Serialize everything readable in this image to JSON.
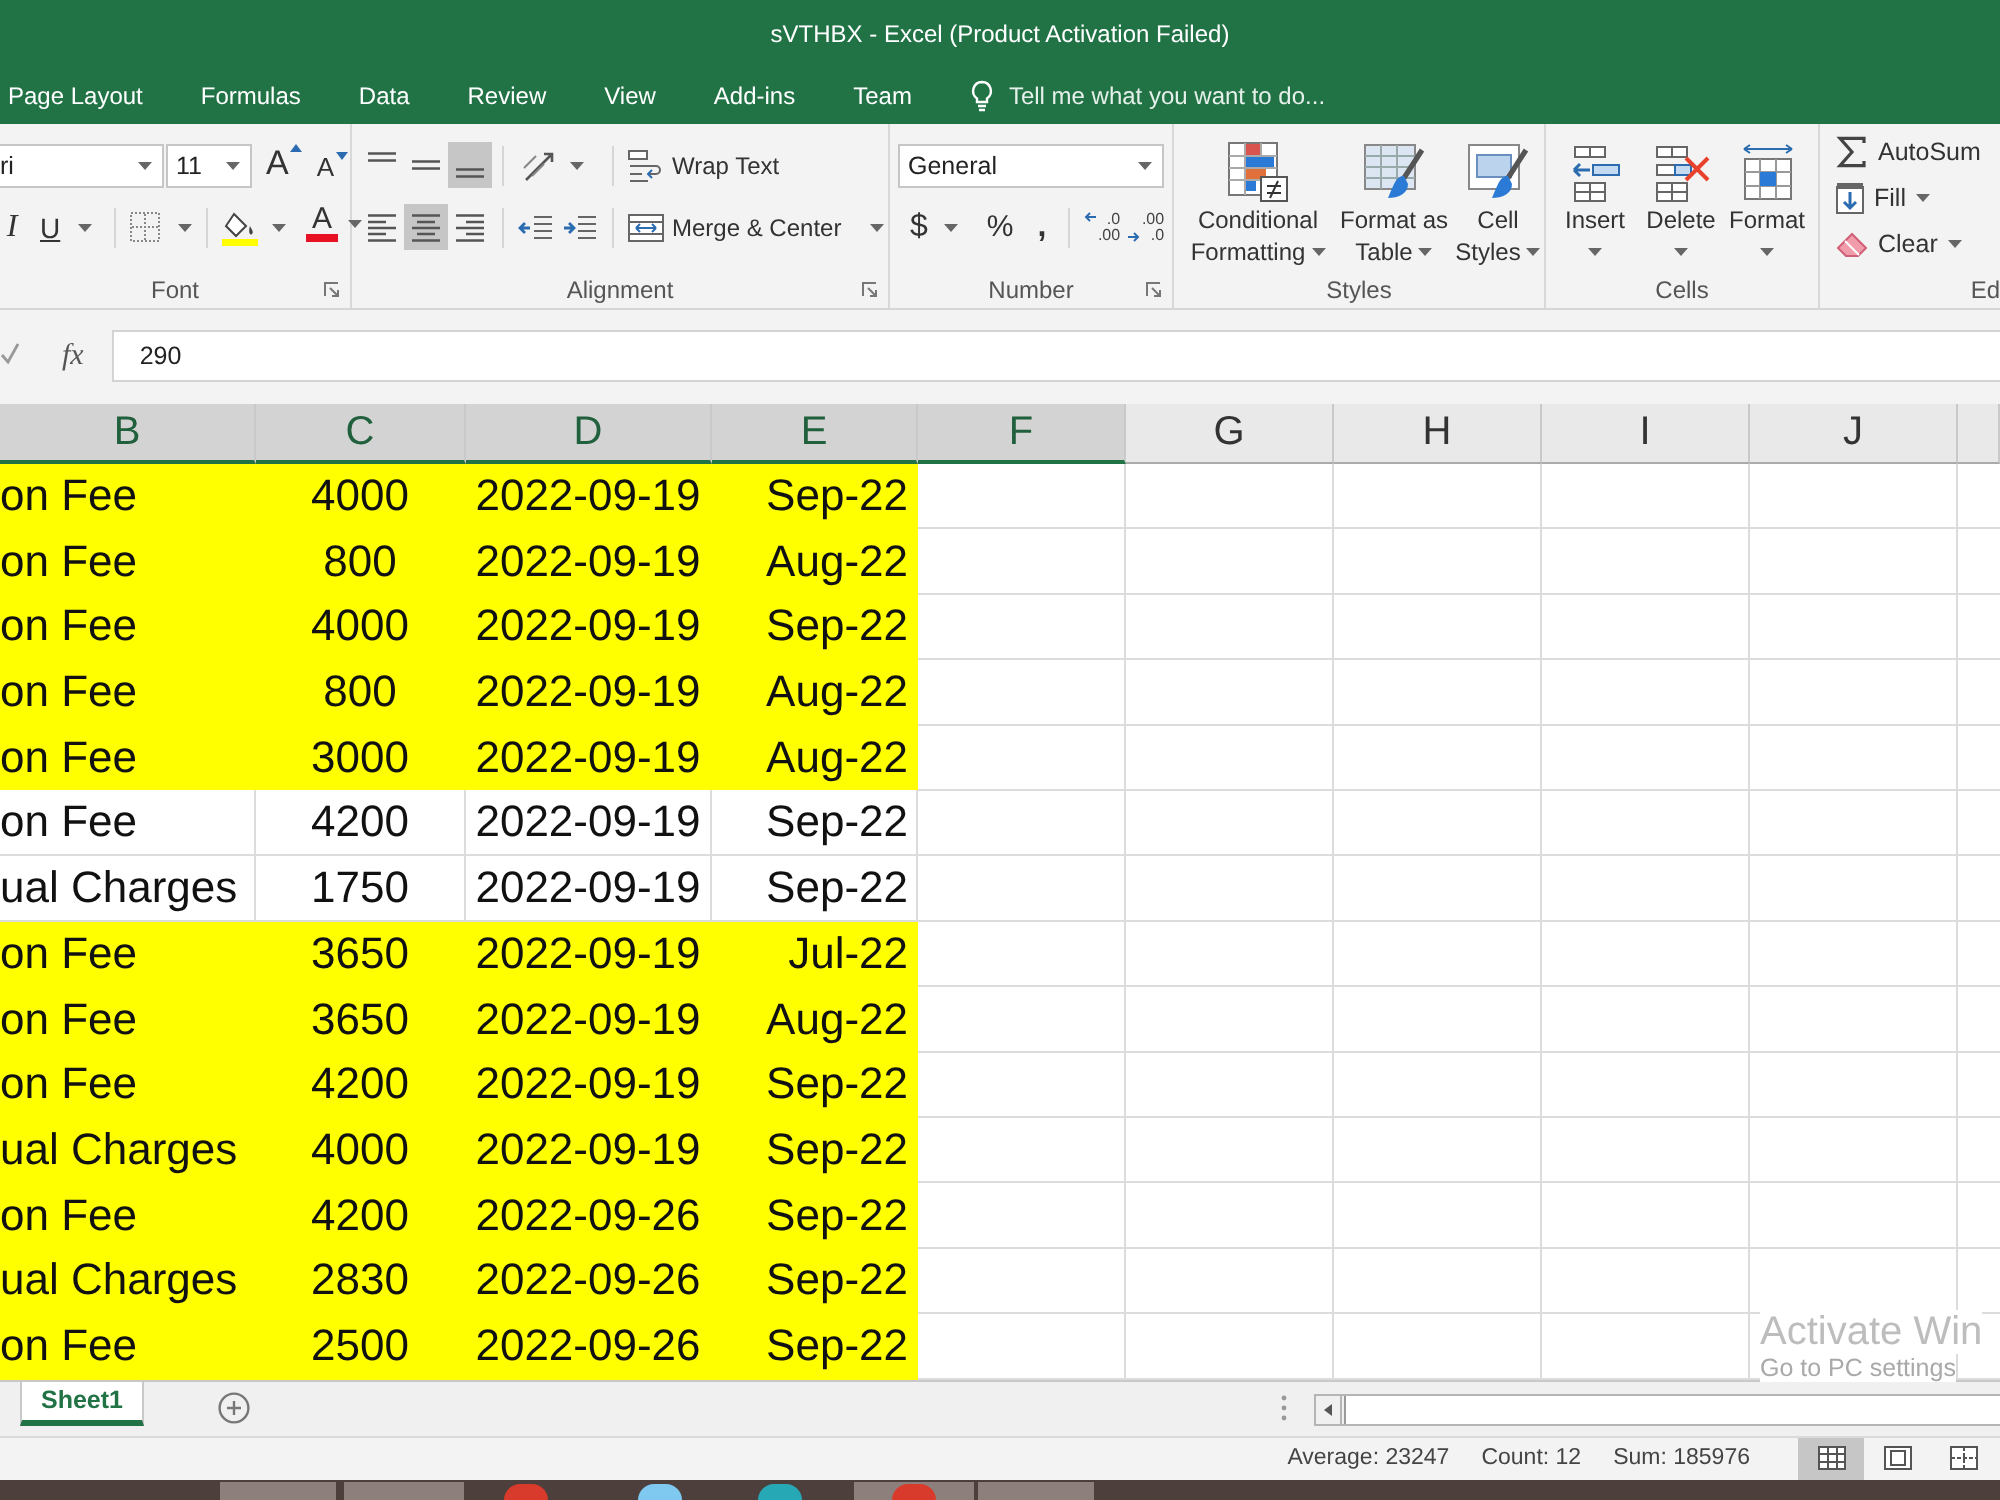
{
  "window": {
    "title": "sVTHBX - Excel (Product Activation Failed)"
  },
  "ribbon_tabs": [
    {
      "label": "Page Layout",
      "selected": false
    },
    {
      "label": "Formulas",
      "selected": false
    },
    {
      "label": "Data",
      "selected": false
    },
    {
      "label": "Review",
      "selected": false
    },
    {
      "label": "View",
      "selected": false
    },
    {
      "label": "Add-ins",
      "selected": false
    },
    {
      "label": "Team",
      "selected": false
    }
  ],
  "tell_me": {
    "placeholder": "Tell me what you want to do..."
  },
  "font_group": {
    "label": "Font",
    "font_name": "ri",
    "font_size": "11",
    "grow_glyph": "A",
    "shrink_glyph": "A",
    "italic_glyph": "I",
    "underline_glyph": "U",
    "font_color_glyph": "A"
  },
  "alignment_group": {
    "label": "Alignment",
    "vertical": [
      {
        "kind": "top",
        "selected": false
      },
      {
        "kind": "middle",
        "selected": false
      },
      {
        "kind": "bottom",
        "selected": true
      }
    ],
    "horizontal": [
      {
        "kind": "left",
        "selected": false
      },
      {
        "kind": "center",
        "selected": true
      },
      {
        "kind": "right",
        "selected": false
      }
    ],
    "wrap_text": "Wrap Text",
    "merge": "Merge & Center"
  },
  "number_group": {
    "label": "Number",
    "format": "General",
    "currency": "$",
    "percent": "%",
    "comma": ",",
    "decimals": [
      {
        "kind": "increase",
        "upper": ".0",
        "lower": ".00"
      },
      {
        "kind": "decrease",
        "upper": ".00",
        "lower": ".0"
      }
    ]
  },
  "styles_group": {
    "label": "Styles",
    "buttons": [
      {
        "kind": "conditional",
        "lines": [
          "Conditional",
          "Formatting"
        ]
      },
      {
        "kind": "table",
        "lines": [
          "Format as",
          "Table"
        ]
      },
      {
        "kind": "cell_styles",
        "lines": [
          "Cell",
          "Styles"
        ]
      }
    ]
  },
  "cells_group": {
    "label": "Cells",
    "buttons": [
      {
        "kind": "insert",
        "label": "Insert"
      },
      {
        "kind": "delete",
        "label": "Delete"
      },
      {
        "kind": "format",
        "label": "Format"
      }
    ]
  },
  "editing_group": {
    "label": "Ed",
    "buttons": [
      {
        "kind": "autosum",
        "label": "AutoSum"
      },
      {
        "kind": "fill",
        "label": "Fill"
      },
      {
        "kind": "clear",
        "label": "Clear"
      }
    ]
  },
  "formula_bar": {
    "function_glyph": "fx",
    "value": "290"
  },
  "sheet": {
    "columns": [
      {
        "label": "B",
        "selected": true
      },
      {
        "label": "C",
        "selected": true
      },
      {
        "label": "D",
        "selected": true
      },
      {
        "label": "E",
        "selected": true
      },
      {
        "label": "F",
        "selected": true
      },
      {
        "label": "G",
        "selected": false
      },
      {
        "label": "H",
        "selected": false
      },
      {
        "label": "I",
        "selected": false
      },
      {
        "label": "J",
        "selected": false
      }
    ],
    "rows": [
      {
        "cells": [
          "on Fee",
          "4000",
          "2022-09-19",
          "Sep-22"
        ],
        "highlighted": true
      },
      {
        "cells": [
          "on Fee",
          "800",
          "2022-09-19",
          "Aug-22"
        ],
        "highlighted": true
      },
      {
        "cells": [
          "on Fee",
          "4000",
          "2022-09-19",
          "Sep-22"
        ],
        "highlighted": true
      },
      {
        "cells": [
          "on Fee",
          "800",
          "2022-09-19",
          "Aug-22"
        ],
        "highlighted": true
      },
      {
        "cells": [
          "on Fee",
          "3000",
          "2022-09-19",
          "Aug-22"
        ],
        "highlighted": true
      },
      {
        "cells": [
          "on Fee",
          "4200",
          "2022-09-19",
          "Sep-22"
        ],
        "highlighted": false
      },
      {
        "cells": [
          "ual Charges",
          "1750",
          "2022-09-19",
          "Sep-22"
        ],
        "highlighted": false
      },
      {
        "cells": [
          "on Fee",
          "3650",
          "2022-09-19",
          "Jul-22"
        ],
        "highlighted": true
      },
      {
        "cells": [
          "on Fee",
          "3650",
          "2022-09-19",
          "Aug-22"
        ],
        "highlighted": true
      },
      {
        "cells": [
          "on Fee",
          "4200",
          "2022-09-19",
          "Sep-22"
        ],
        "highlighted": true
      },
      {
        "cells": [
          "ual Charges",
          "4000",
          "2022-09-19",
          "Sep-22"
        ],
        "highlighted": true
      },
      {
        "cells": [
          "on Fee",
          "4200",
          "2022-09-26",
          "Sep-22"
        ],
        "highlighted": true
      },
      {
        "cells": [
          "ual Charges",
          "2830",
          "2022-09-26",
          "Sep-22"
        ],
        "highlighted": true
      },
      {
        "cells": [
          "on Fee",
          "2500",
          "2022-09-26",
          "Sep-22"
        ],
        "highlighted": true
      }
    ]
  },
  "sheet_tabs": [
    {
      "label": "Sheet1",
      "selected": true
    }
  ],
  "activation_notice": {
    "title": "Activate Win",
    "subtitle": "Go to PC settings"
  },
  "status_bar": {
    "average": "Average: 23247",
    "count": "Count: 12",
    "sum": "Sum: 185976",
    "views": [
      {
        "kind": "normal",
        "selected": true
      },
      {
        "kind": "page_layout",
        "selected": false
      },
      {
        "kind": "page_break",
        "selected": false
      }
    ]
  }
}
